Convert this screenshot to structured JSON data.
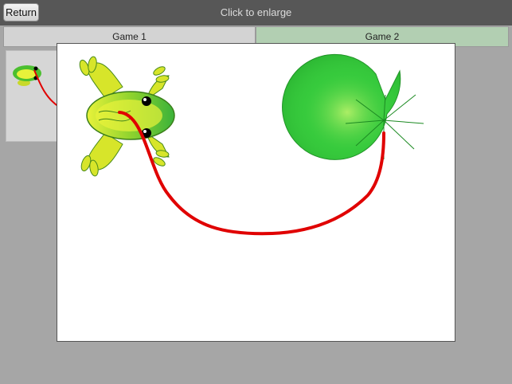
{
  "header": {
    "return_label": "Return",
    "title": "Click to enlarge"
  },
  "tabs": [
    {
      "label": "Game 1",
      "selected": false
    },
    {
      "label": "Game 2",
      "selected": true
    }
  ],
  "thumbnail": {
    "icons": [
      "frog-icon",
      "path-line"
    ]
  },
  "canvas": {
    "icons": [
      "frog-icon",
      "lily-pad-icon"
    ],
    "path_color": "#e00000"
  },
  "colors": {
    "topbar": "#575757",
    "background": "#a6a6a6",
    "tab_selected": "#b2cfb2",
    "tab_unselected": "#d3d3d3",
    "frog_green": "#4bbf2f",
    "frog_yellow": "#e8f23a",
    "lily_pad": "#35c93b"
  }
}
